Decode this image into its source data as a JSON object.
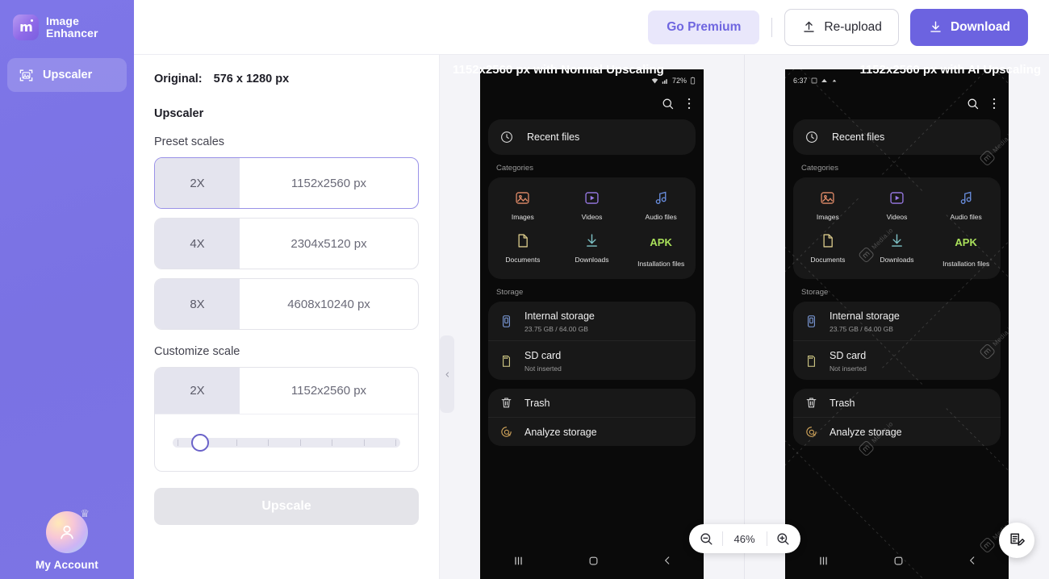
{
  "brand": {
    "name_line1": "Image",
    "name_line2": "Enhancer",
    "logo_mark": "m"
  },
  "sidebar": {
    "items": [
      {
        "label": "Upscaler",
        "icon": "upscale-icon"
      }
    ],
    "account": {
      "label": "My Account",
      "icon": "avatar-crown-icon"
    }
  },
  "topbar": {
    "go_premium": "Go Premium",
    "reupload": "Re-upload",
    "download": "Download",
    "upload_icon": "upload-icon",
    "download_icon": "download-icon"
  },
  "settings": {
    "original_label": "Original:",
    "original_value": "576 x 1280 px",
    "section_title": "Upscaler",
    "preset_label": "Preset scales",
    "presets": [
      {
        "scale": "2X",
        "size": "1152x2560 px",
        "selected": true
      },
      {
        "scale": "4X",
        "size": "2304x5120 px",
        "selected": false
      },
      {
        "scale": "8X",
        "size": "4608x10240 px",
        "selected": false
      }
    ],
    "customize_label": "Customize scale",
    "custom": {
      "scale": "2X",
      "size": "1152x2560 px",
      "slider_position_pct": 12
    },
    "upscale_button": "Upscale"
  },
  "preview": {
    "collapse_icon": "chevron-left-icon",
    "left_pane_label": "1152x2560 px with Normal Upscaling",
    "right_pane_label": "1152x2560 px with AI Upscaling",
    "zoom": {
      "value": "46%",
      "zoom_out_icon": "zoom-out-icon",
      "zoom_in_icon": "zoom-in-icon"
    },
    "feedback_icon": "feedback-note-icon",
    "watermark": {
      "text": "Media.io",
      "mark": "m"
    }
  },
  "phone": {
    "status_left": "6:37",
    "status_right": "72%",
    "search_icon": "search-icon",
    "more_icon": "more-vertical-icon",
    "recent": {
      "label": "Recent files",
      "icon": "clock-icon"
    },
    "categories_header": "Categories",
    "categories": [
      {
        "label": "Images",
        "icon": "image-icon"
      },
      {
        "label": "Videos",
        "icon": "video-icon"
      },
      {
        "label": "Audio files",
        "icon": "music-note-icon"
      },
      {
        "label": "Documents",
        "icon": "document-icon"
      },
      {
        "label": "Downloads",
        "icon": "download-arrow-icon"
      },
      {
        "label": "Installation files",
        "icon": "apk-icon",
        "badge": "APK"
      }
    ],
    "storage_header": "Storage",
    "storage": [
      {
        "title": "Internal storage",
        "subtitle": "23.75 GB / 64.00 GB",
        "icon": "phone-storage-icon"
      },
      {
        "title": "SD card",
        "subtitle": "Not inserted",
        "icon": "sd-card-icon"
      }
    ],
    "actions": [
      {
        "title": "Trash",
        "icon": "trash-icon"
      },
      {
        "title": "Analyze storage",
        "icon": "analyze-storage-icon"
      }
    ],
    "navbar": {
      "recents_icon": "recents-icon",
      "home_icon": "home-icon",
      "back_icon": "back-icon"
    }
  },
  "colors": {
    "accent": "#6c63e0",
    "sidebar": "#7a72e3",
    "premium_bg": "#e9e7fb",
    "apk_green": "#a9e05a"
  }
}
